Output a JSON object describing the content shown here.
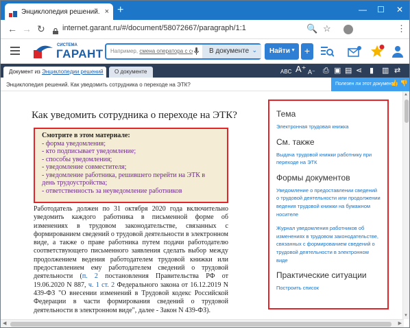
{
  "browser": {
    "tab_title": "Энциклопедия решений. Как уведомить сотрудника о переходе на ЭТК?",
    "tab_close": "×",
    "new_tab": "+",
    "min": "—",
    "max": "☐",
    "close": "✕",
    "back": "←",
    "forward": "→",
    "reload": "↻",
    "url": "internet.garant.ru/#/document/58072667/paragraph/1:1",
    "search_icon": "🔍",
    "star": "☆",
    "menu": "⋮"
  },
  "app": {
    "logo_small": "СИСТЕМА",
    "logo_big": "ГАРАНТ",
    "search_placeholder_prefix": "Например, ",
    "search_placeholder_link": "смена оператора с сохранением",
    "scope_label": "В документе",
    "find_button": "Найти",
    "plus_button": "+",
    "brand_color": "#1c5fa8",
    "accent_color": "#2f7fd4"
  },
  "doc_tabs": {
    "tab1_prefix": "Документ из ",
    "tab1_link": "Энциклопедии решений",
    "tab2": "О документе"
  },
  "docline": {
    "title": "Энциклопедия решений. Как уведомить сотрудника о переходе на ЭТК?",
    "useful_prompt": "Полезен ли этот документ?"
  },
  "document": {
    "title": "Как уведомить сотрудника о переходе на ЭТК?",
    "see_also_header": "Смотрите в этом материале:",
    "see_also_items": [
      "- форма уведомления;",
      "- кто подписывает уведомление;",
      "- способы уведомления;",
      "- уведомление совместителя;",
      "- уведомление работника, решившего перейти на ЭТК в день трудоустройства;",
      "- ответственность за неуведомление работников"
    ],
    "para_1": "Работодатель должен по 31 октября 2020 года включительно уведомить каждого работника в письменной форме об изменениях в трудовом законодательстве, связанных с формированием сведений о трудовой деятельности в электронном виде, а также о праве работника путем подачи работодателю соответствующего письменного заявления сделать выбор между продолжением ведения работодателем трудовой книжки или предоставлением ему работодателем сведений о трудовой деятельности (",
    "para_link_1": "п. 2",
    "para_2": " постановления Правительства РФ от 19.06.2020 N 887, ",
    "para_link_2": "ч. 1 ст. 2",
    "para_3": " Федерального закона от 16.12.2019 N 439-ФЗ \"О внесении изменений в Трудовой кодекс Российской Федерации в части формирования сведений о трудовой деятельности в электронном виде\", далее - Закон N 439-ФЗ)."
  },
  "right_panel": {
    "topic_header": "Тема",
    "topic_link": "Электронная трудовая книжка",
    "seealso_header": "См. также",
    "seealso_link": "Выдача трудовой книжки работнику при переходе на ЭТК",
    "forms_header": "Формы документов",
    "forms_link_1": "Уведомление о предоставлении сведений о трудовой деятельности или продолжении ведения трудовой книжки на бумажном носителе",
    "forms_link_2": "Журнал уведомления работников об изменениях в трудовом законодательстве, связанных с формированием сведений о трудовой деятельности в электронном виде",
    "situations_header": "Практические ситуации",
    "situations_link": "Построить список"
  }
}
